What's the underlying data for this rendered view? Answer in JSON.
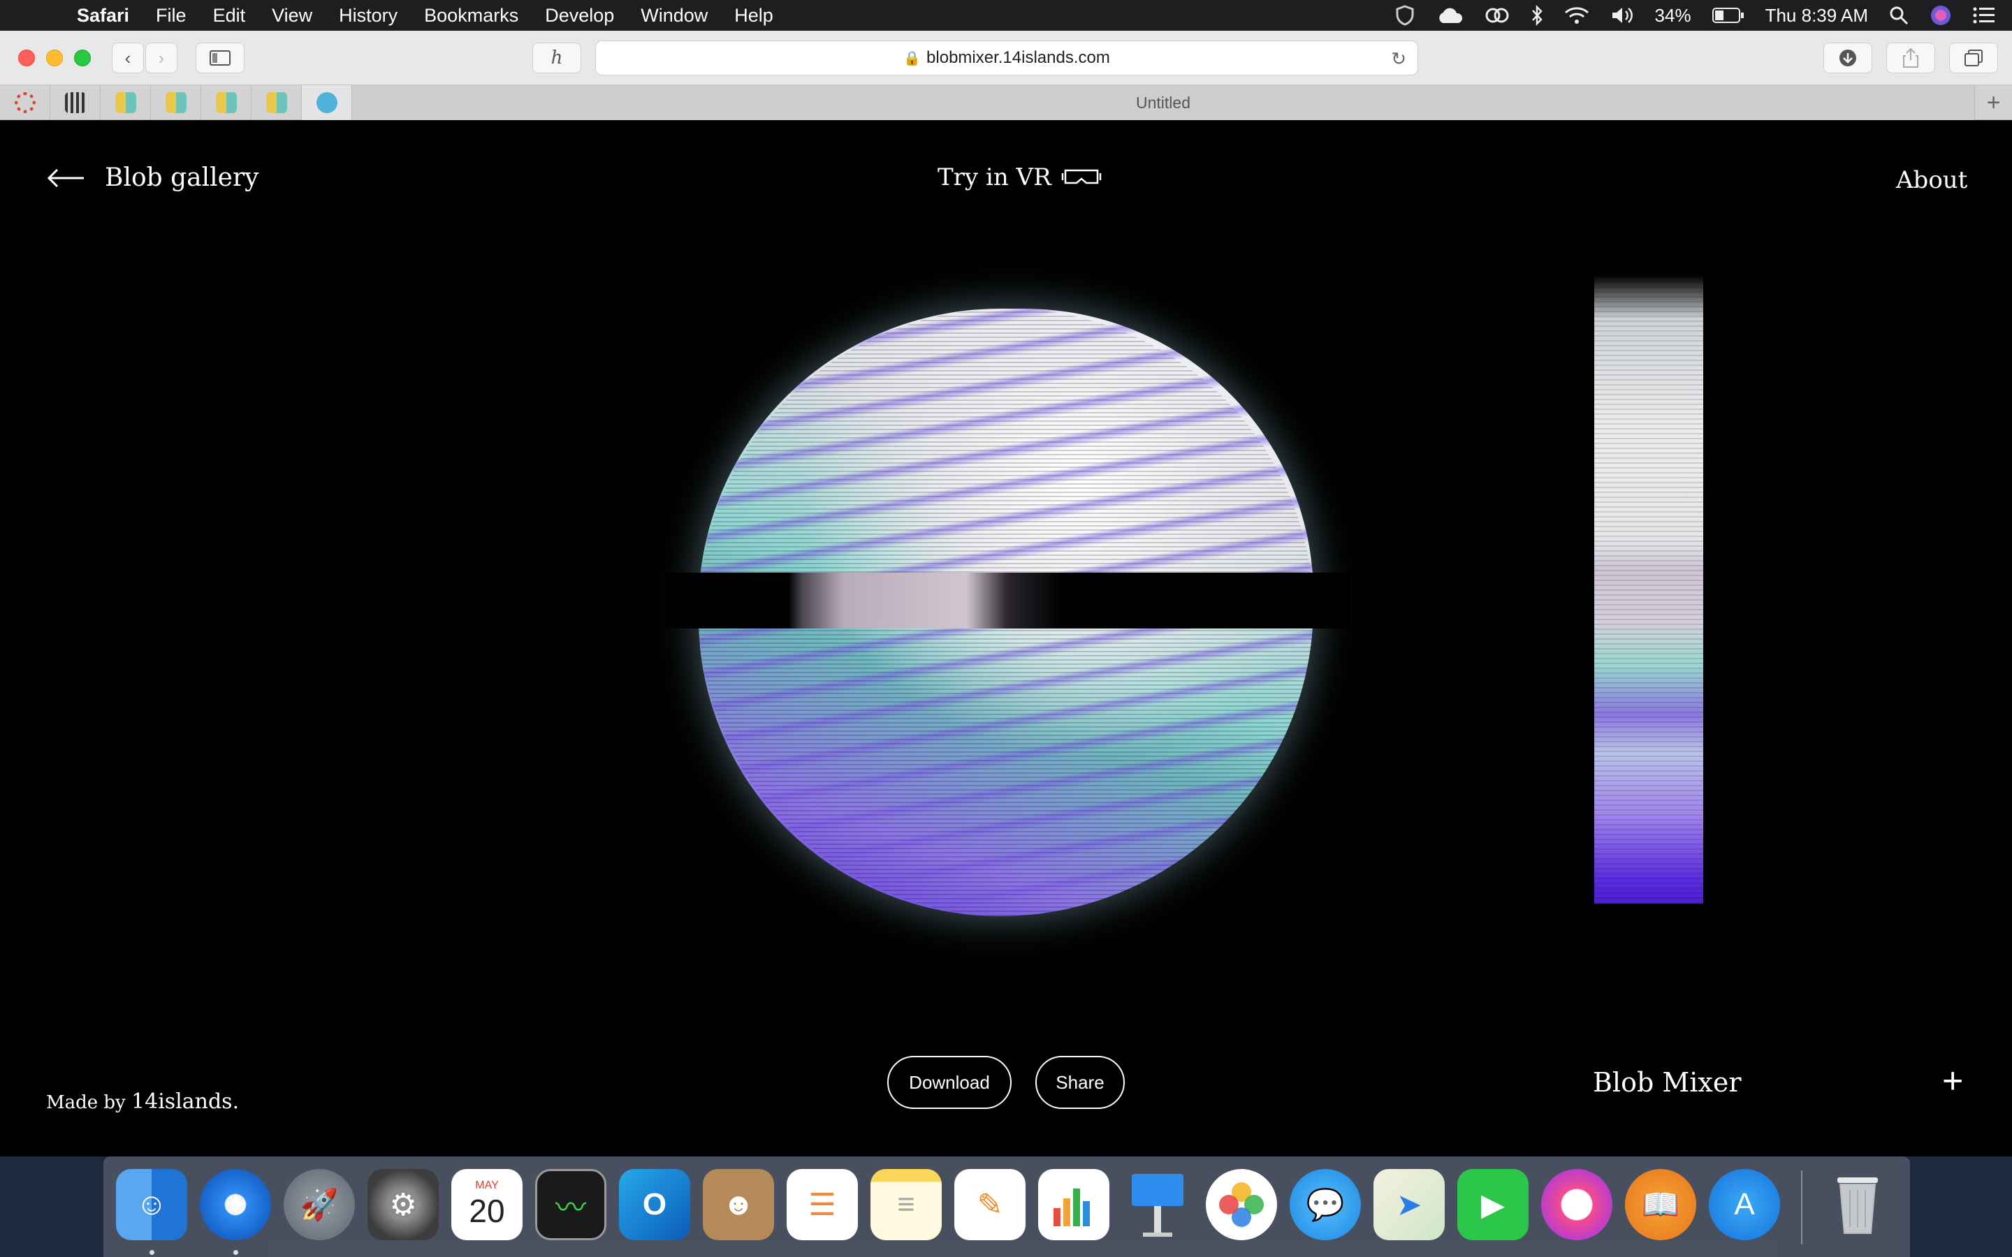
{
  "menubar": {
    "app_name": "Safari",
    "items": [
      "File",
      "Edit",
      "View",
      "History",
      "Bookmarks",
      "Develop",
      "Window",
      "Help"
    ],
    "battery": "34%",
    "clock": "Thu 8:39 AM"
  },
  "browser": {
    "url": "blobmixer.14islands.com",
    "tab_title": "Untitled"
  },
  "page": {
    "back_label": "Blob gallery",
    "vr_label": "Try in VR",
    "about_label": "About",
    "made_by_prefix": "Made by",
    "made_by_brand": "14islands.",
    "download_label": "Download",
    "share_label": "Share",
    "product_title": "Blob Mixer",
    "plus_label": "+"
  },
  "dock": {
    "calendar_month": "MAY",
    "calendar_day": "20",
    "apps": [
      "finder-icon",
      "safari-icon",
      "launchpad-icon",
      "system-preferences-icon",
      "calendar-icon",
      "activity-monitor-icon",
      "outlook-icon",
      "contacts-icon",
      "reminders-icon",
      "notes-icon",
      "pages-icon",
      "numbers-icon",
      "keynote-icon",
      "photos-icon",
      "messages-icon",
      "maps-icon",
      "facetime-icon",
      "itunes-icon",
      "books-icon",
      "app-store-icon",
      "trash-icon"
    ]
  },
  "colors": {
    "page_bg": "#000000",
    "blob_teal": "#8fd6d2",
    "blob_violet": "#5a2fd8",
    "blob_white": "#f2f2f4"
  }
}
